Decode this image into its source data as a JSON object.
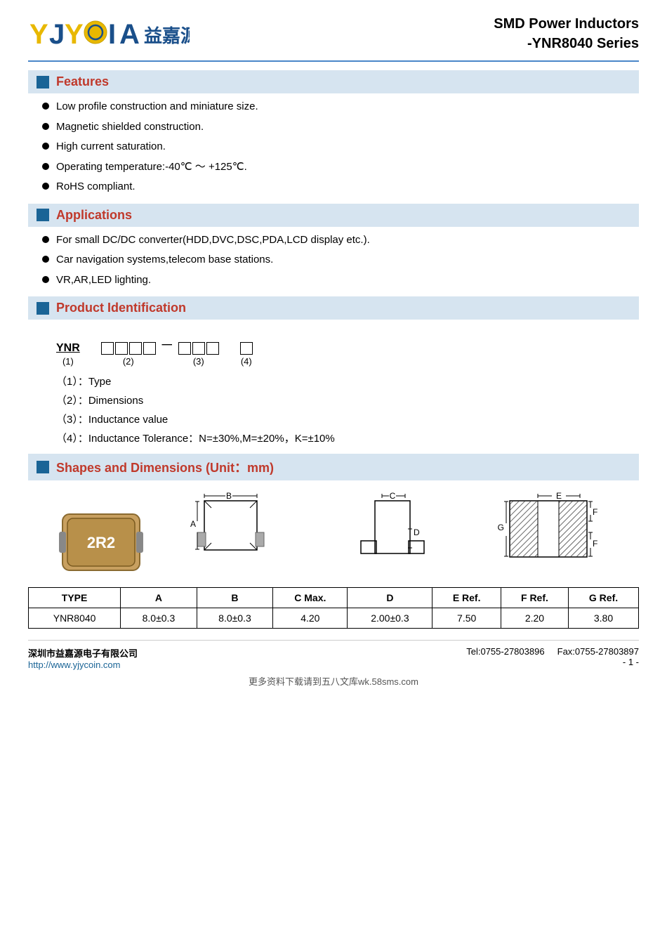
{
  "header": {
    "logo_brand": "YJYC⊙IA",
    "logo_chinese": "益嘉源",
    "product_line1": "SMD Power Inductors",
    "product_line2": "-YNR8040 Series"
  },
  "features": {
    "title": "Features",
    "items": [
      "Low profile construction and miniature size.",
      "Magnetic shielded construction.",
      "High current saturation.",
      "Operating temperature:-40℃ ～ +125℃.",
      "RoHS compliant."
    ]
  },
  "applications": {
    "title": "Applications",
    "items": [
      "For small DC/DC converter(HDD,DVC,DSC,PDA,LCD display etc.).",
      "Car navigation systems,telecom base stations.",
      "VR,AR,LED lighting."
    ]
  },
  "product_identification": {
    "title": "Product Identification",
    "codes": [
      {
        "num": "(1)",
        "label": "Type"
      },
      {
        "num": "(2)",
        "label": "Dimensions"
      },
      {
        "num": "(3)",
        "label": "Inductance value"
      },
      {
        "num": "(4)",
        "label": "Inductance Tolerance：N=±30%,M=±20%，K=±10%"
      }
    ]
  },
  "shapes": {
    "title": "Shapes and Dimensions (Unit：mm)",
    "table": {
      "headers": [
        "TYPE",
        "A",
        "B",
        "C Max.",
        "D",
        "E Ref.",
        "F Ref.",
        "G Ref."
      ],
      "rows": [
        [
          "YNR8040",
          "8.0±0.3",
          "8.0±0.3",
          "4.20",
          "2.00±0.3",
          "7.50",
          "2.20",
          "3.80"
        ]
      ]
    }
  },
  "footer": {
    "company": "深圳市益嘉源电子有限公司",
    "website": "http://www.yjycoin.com",
    "tel": "Tel:0755-27803896",
    "fax": "Fax:0755-27803897",
    "page": "- 1 -",
    "watermark": "更多资料下载请到五八文库wk.58sms.com"
  }
}
